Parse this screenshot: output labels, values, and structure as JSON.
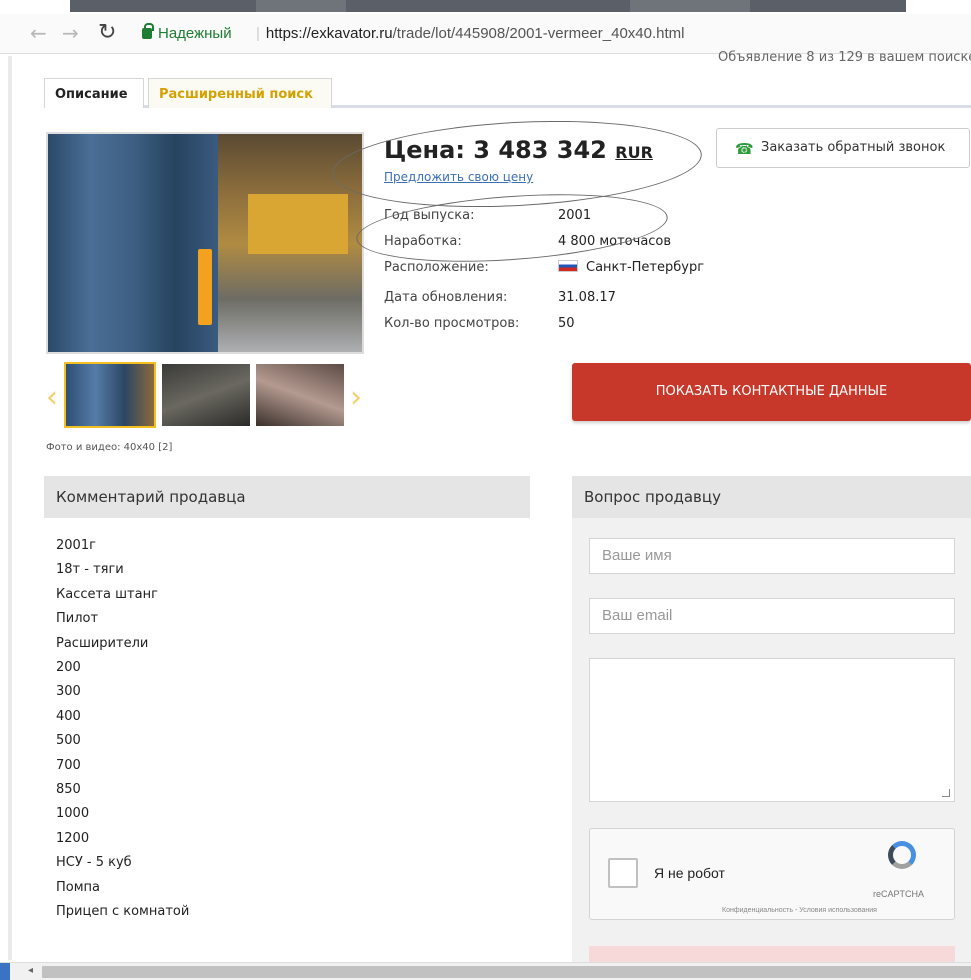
{
  "browser": {
    "secure_label": "Надежный",
    "url_domain": "https://exkavator.ru",
    "url_path": "/trade/lot/445908/2001-vermeer_40x40.html"
  },
  "header": {
    "ad_count": "Объявление 8 из 129 в вашем поиске"
  },
  "tabs": [
    {
      "label": "Описание"
    },
    {
      "label": "Расширенный поиск"
    }
  ],
  "gallery": {
    "caption": "Фото и видео: 40x40 [2]"
  },
  "price": {
    "label": "Цена: 3 483 342",
    "currency": "RUR",
    "offer_link": "Предложить свою цену"
  },
  "callback": {
    "label": "Заказать обратный звонок"
  },
  "specs": [
    {
      "label": "Год выпуска:",
      "value": "2001"
    },
    {
      "label": "Наработка:",
      "value": "4 800 моточасов"
    },
    {
      "label": "Расположение:",
      "value": "Санкт-Петербург"
    },
    {
      "label": "Дата обновления:",
      "value": "31.08.17"
    },
    {
      "label": "Кол-во просмотров:",
      "value": "50"
    }
  ],
  "contacts_button": "ПОКАЗАТЬ КОНТАКТНЫЕ ДАННЫЕ",
  "comment": {
    "title": "Комментарий продавца",
    "lines": [
      "2001г",
      "18т - тяги",
      "Кассета штанг",
      "Пилот",
      "Расширители",
      "200",
      "300",
      "400",
      "500",
      "700",
      "850",
      "1000",
      "1200",
      "НСУ - 5 куб",
      "Помпа",
      "Прицеп с комнатой"
    ]
  },
  "question": {
    "title": "Вопрос продавцу",
    "name_placeholder": "Ваше имя",
    "email_placeholder": "Ваш email",
    "captcha_label": "Я не робот",
    "captcha_brand": "reCAPTCHA",
    "captcha_terms": "Конфиденциальность - Условия использования"
  }
}
